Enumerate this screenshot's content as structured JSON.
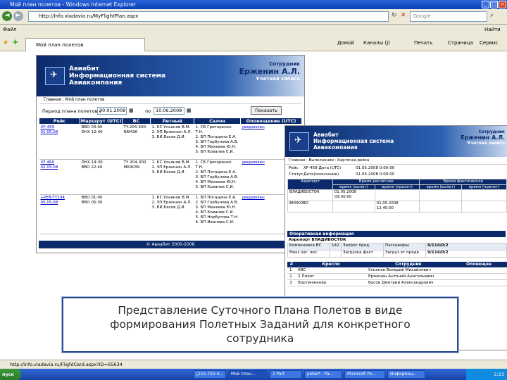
{
  "browser": {
    "title": "Мой план полетов - Windows Internet Explorer",
    "url": "http://lnfo.vladavia.ru/MyFlightPlan.aspx",
    "search_placeholder": "Google",
    "menu_left": "Файл",
    "menu_right": "Найти",
    "tab_label": "Мой план полетов",
    "tools": [
      "Домой",
      "Каналы (J)",
      "Печать",
      "Страница",
      "Сервис"
    ],
    "status_text": "http://info.vladavia.ru/FlightCard.aspx?ID=65634"
  },
  "win1": {
    "app_line1": "Авиабит",
    "app_line2": "Информационная система",
    "app_line3": "Авиакомпания",
    "emp_label": "Сотрудник",
    "emp_name": "Ерженин А.Л.",
    "emp_sub": "Учетная запись",
    "breadcrumb": "Главная : Мой план полетов",
    "period_label": "Период плана полетов с",
    "date_from": "30.01.2008",
    "to_label": "по",
    "date_to": "10.06.2008",
    "show_button": "Показать",
    "columns": [
      "Рейс",
      "Маршрут (UTC)",
      "ВС",
      "Летный",
      "Салон",
      "Оповещение (UTC)"
    ],
    "rows": [
      {
        "flight": "XF-459\n01.05.08",
        "route": "ВВО 03:00\nDHX 12:40",
        "ac": "TY-204-300\nN6M26",
        "crew": "1. КС Ульянов В.М.\n2. ЭП Ерженин А.Л.\n3. БИ Басов Д.И.",
        "cabin": "1. СБ Григоренко Т.Н.\n2. БП Погадина Е.А.\n3. БП Горбунова А.В.\n4. БП Михеева Ю.Н.\n5. БП Ковалев С.И.",
        "notify": "уведомлен"
      },
      {
        "flight": "XF 460\n02.05.08",
        "route": "DHX 14:30\nВВО 22:40",
        "ac": "TY 204-300\nM64039",
        "crew": "1. КС Ульянов В.М.\n2. ЗП Ерженин А.Л.\n3. БИ Басов Д.И.",
        "cabin": "1. СБ Григоренко Т.Н.\n2. БП Погадина Е.А.\n3. БП Горбунова А.В.\n4. БП Михеева Ю.Н.\n5. БП Ковалев С.И.",
        "notify": "уведомлен"
      },
      {
        "flight": "+PEB-TY104\n05.05.08",
        "route": "ВВО 01:00\nВВО 05:30",
        "ac": "",
        "crew": "1. КС Ульянов В.М.\n2. ЗП Ерженин А.Л.\n3. БИ Басов Д.И.",
        "cabin": "1. БП Погадина Е.А.\n2. БП Горбунова А.В.\n3. БП Михеева Ю.Н.\n4. БП Ковалев С.И.\n5. БП Норбутова Т.Н.\n6. БП Иванова С.И.",
        "notify": "уведомлен"
      }
    ],
    "footer": "© Авиабит 2000-2008"
  },
  "win2": {
    "app_line1": "Авиабит",
    "app_line2": "Информационная система",
    "app_line3": "Авиакомпания",
    "emp_label": "Сотрудник",
    "emp_name": "Ерженин А.Л.",
    "emp_sub": "Учетная запись",
    "breadcrumb": "Главная : Выполнение : Карточка рейса",
    "flight_label": "Рейс",
    "flight_value": "XF-459 Дата (UTC)",
    "flight_time": "01.05.2008 0:00:00",
    "status_label": "Статус",
    "status_value": "Дата(окончание)",
    "status_time": "01.05.2008 0:00:00",
    "sched_headers": [
      "Аэропорт",
      "время (вылет)",
      "время (прилет)",
      "время (вылет)",
      "время (прилет)"
    ],
    "sched_group1": "Время расчетное",
    "sched_group2": "Время фактическое",
    "sched_rows": [
      "ВЛАДИВОСТОК",
      "ВНУКОВО"
    ],
    "sched_times": [
      "01.05.2008\n03:00:00",
      "01.05.2008\n12:40:00"
    ],
    "ops_title": "Оперативная информация",
    "ops_airport": "Аэропорт ВЛАДИВОСТОК",
    "ops_rows": [
      [
        "Компоновка ВС",
        "142",
        "Запрос прод.",
        "Пассажиры",
        "9/114/0/2"
      ],
      [
        "Макс.заг. вес",
        "",
        "Загрузка факт",
        "Загруз от предв",
        "9/114/0/2"
      ]
    ],
    "crew_headers": [
      "#",
      "Кресло",
      "Сотрудник",
      "Оповещен"
    ],
    "crew_rows": [
      [
        "1",
        "КВС",
        "Ульянов Валерий Михайлович",
        ""
      ],
      [
        "2",
        "2 Пилот",
        "Ерженин Антоний Анатольевич",
        ""
      ],
      [
        "3",
        "Бортинженер",
        "Басов Дмитрий Александрович",
        ""
      ]
    ]
  },
  "caption": {
    "line1": "Представление Суточного Плана Полетов в виде",
    "line2": "формирования Полетных Заданий для конкретного",
    "line3": "сотрудника"
  },
  "taskbar": {
    "start": "пуск",
    "tasks": [
      "[215-750-4...",
      "Мой план...",
      "2 Part",
      "pobol* - Pa...",
      "Microsoft Po...",
      "Информац..."
    ],
    "clock": "2:23"
  }
}
